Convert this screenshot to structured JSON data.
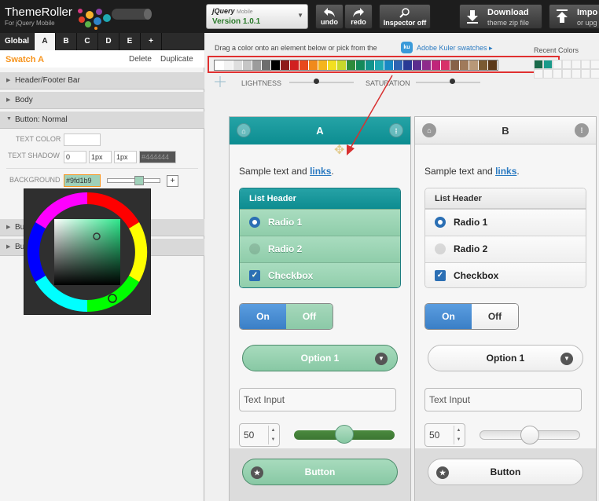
{
  "app": {
    "title": "ThemeRoller",
    "subtitle": "For jQuery Mobile"
  },
  "version": {
    "brand": "jQuery",
    "brand_sub": "Mobile",
    "label": "Version 1.0.1"
  },
  "toolbar": {
    "undo": "undo",
    "redo": "redo",
    "inspector_label": "Inspector",
    "inspector_state": "off",
    "download_title": "Download",
    "download_sub": "theme zip file",
    "import_title": "Impo",
    "import_sub": "or upg"
  },
  "tabs": [
    "Global",
    "A",
    "B",
    "C",
    "D",
    "E",
    "+"
  ],
  "swatch": {
    "name": "Swatch A",
    "delete": "Delete",
    "duplicate": "Duplicate"
  },
  "sections": {
    "header_footer": "Header/Footer Bar",
    "body": "Body",
    "button_normal": "Button: Normal",
    "bu1": "Bu",
    "bu2": "Bu"
  },
  "props": {
    "text_color_label": "TEXT COLOR",
    "text_shadow_label": "TEXT SHADOW",
    "shadow_x": "0",
    "shadow_y": "1px",
    "shadow_blur": "1px",
    "shadow_color": "#444444",
    "background_label": "BACKGROUND",
    "background_value": "#9fd1b9",
    "add": "+"
  },
  "content": {
    "drag_hint": "Drag a color onto an element below or pick from the",
    "kuler_icon": "ku",
    "kuler_link": "Adobe Kuler swatches ▸",
    "recent_label": "Recent Colors",
    "lightness": "LIGHTNESS",
    "saturation": "SATURATION",
    "palette": [
      "#ffffff",
      "#f2f2f2",
      "#dedede",
      "#c6c6c6",
      "#9c9c9c",
      "#6e6e6e",
      "#000000",
      "#8e1a1a",
      "#d12020",
      "#e84a1d",
      "#f08a1c",
      "#f5b51d",
      "#f2df21",
      "#c7d72b",
      "#2e8b3b",
      "#148a5a",
      "#12948c",
      "#1fa8b2",
      "#1889c5",
      "#2f64b2",
      "#283a95",
      "#5b2d8e",
      "#8e2a8b",
      "#c0257a",
      "#d8316a",
      "#876248",
      "#a07a5a",
      "#b89878",
      "#7a5a32",
      "#5c3a1a"
    ],
    "recent_colors": [
      "#1a6a4a",
      "#1a9a8a"
    ]
  },
  "preview_a": {
    "title": "A",
    "home_icon": "⌂",
    "grid_icon": "⁞",
    "sample_text": "Sample text and ",
    "sample_link": "links",
    "sample_end": ".",
    "list_header": "List Header",
    "radio1": "Radio 1",
    "radio2": "Radio 2",
    "checkbox": "Checkbox",
    "on": "On",
    "off": "Off",
    "select_value": "Option 1",
    "text_input": "Text Input",
    "number": "50",
    "button": "Button",
    "slider_value": 50
  },
  "preview_b": {
    "title": "B",
    "home_icon": "⌂",
    "grid_icon": "⁞",
    "sample_text": "Sample text and ",
    "sample_link": "links",
    "sample_end": ".",
    "list_header": "List Header",
    "radio1": "Radio 1",
    "radio2": "Radio 2",
    "checkbox": "Checkbox",
    "on": "On",
    "off": "Off",
    "select_value": "Option 1",
    "text_input": "Text Input",
    "number": "50",
    "button": "Button",
    "slider_value": 50
  },
  "colors": {
    "accent_orange": "#f7941d",
    "swatch_a_bar": "#0c8d91",
    "swatch_a_body": "#9fd1b9",
    "link_blue": "#2a7ac1",
    "highlight_red": "#e03030"
  }
}
